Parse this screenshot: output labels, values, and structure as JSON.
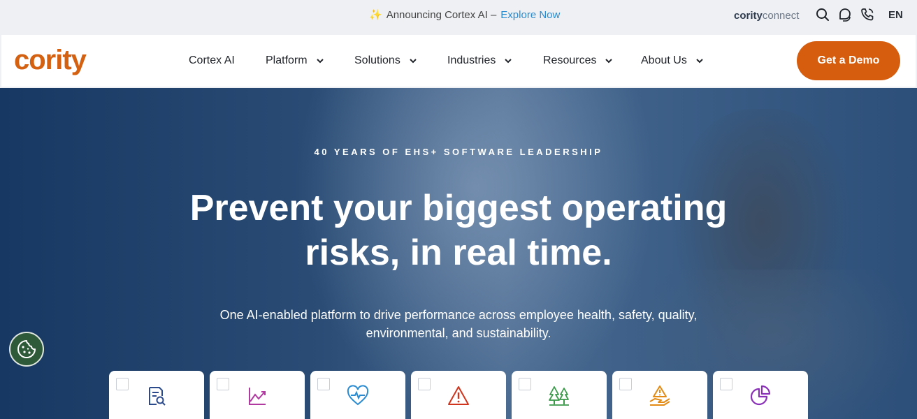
{
  "announcement": {
    "text": "Announcing Cortex AI –",
    "link": "Explore Now"
  },
  "connect": {
    "brand": "cority",
    "suffix": "connect"
  },
  "top_icons": [
    "search-icon",
    "chat-icon",
    "phone-icon"
  ],
  "language": "EN",
  "logo": "cority",
  "nav": {
    "items": [
      {
        "label": "Cortex AI",
        "has_menu": false
      },
      {
        "label": "Platform",
        "has_menu": true
      },
      {
        "label": "Solutions",
        "has_menu": true
      },
      {
        "label": "Industries",
        "has_menu": true
      },
      {
        "label": "Resources",
        "has_menu": true
      },
      {
        "label": "About Us",
        "has_menu": true
      }
    ],
    "cta": "Get a Demo"
  },
  "hero": {
    "eyebrow": "40 YEARS OF EHS+ SOFTWARE LEADERSHIP",
    "headline_1": "Prevent your biggest operating",
    "headline_2": "risks, in real time.",
    "sub_1": "One AI-enabled platform to drive performance across employee health, safety, quality,",
    "sub_2": "environmental, and sustainability."
  },
  "cards": [
    {
      "icon": "document-search-icon",
      "color": "#2b4a8c"
    },
    {
      "icon": "trend-chart-icon",
      "color": "#b03aa0"
    },
    {
      "icon": "heart-pulse-icon",
      "color": "#2a8bd1"
    },
    {
      "icon": "warning-triangle-icon",
      "color": "#d0341c"
    },
    {
      "icon": "trees-icon",
      "color": "#3a9a4a"
    },
    {
      "icon": "hand-warning-icon",
      "color": "#e38a14"
    },
    {
      "icon": "pie-chart-icon",
      "color": "#8a2fb8"
    }
  ],
  "colors": {
    "brand": "#d46012",
    "cta": "#d65d0e",
    "link": "#2a8bd1",
    "hero": "#163862"
  }
}
